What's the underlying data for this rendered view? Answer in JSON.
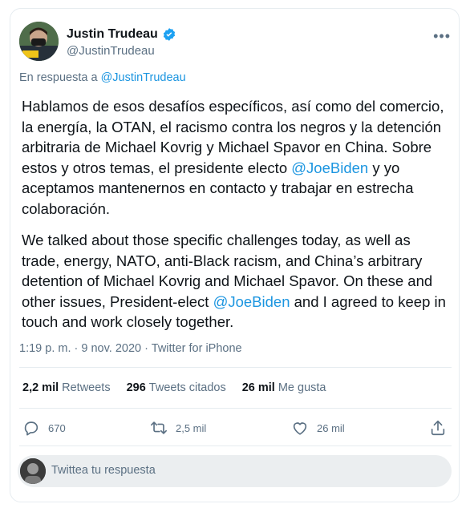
{
  "author": {
    "name": "Justin Trudeau",
    "handle": "@JustinTrudeau"
  },
  "reply_context": {
    "prefix": "En respuesta a",
    "mention": "@JustinTrudeau"
  },
  "tweet": {
    "p1_before": "Hablamos de esos desafíos específicos, así como del comercio, la energía, la OTAN, el racismo contra los negros y la detención arbitraria de Michael Kovrig y Michael Spavor en China. Sobre estos y otros temas, el presidente electo ",
    "p1_mention": "@JoeBiden",
    "p1_after": " y yo aceptamos mantenernos en contacto y trabajar en estrecha colaboración.",
    "p2_before": "We talked about those specific challenges today, as well as trade, energy, NATO, anti-Black racism, and China’s arbitrary detention of Michael Kovrig and Michael Spavor. On these and other issues, President-elect ",
    "p2_mention": "@JoeBiden",
    "p2_after": " and I agreed to keep in touch and work closely together."
  },
  "meta": {
    "time": "1:19 p. m.",
    "separator": "·",
    "date": "9 nov. 2020",
    "source": "Twitter for iPhone"
  },
  "stats": {
    "retweets_count": "2,2 mil",
    "retweets_label": "Retweets",
    "quotes_count": "296",
    "quotes_label": "Tweets citados",
    "likes_count": "26 mil",
    "likes_label": "Me gusta"
  },
  "actions": {
    "reply_count": "670",
    "retweet_count": "2,5 mil",
    "like_count": "26 mil"
  },
  "reply_box": {
    "placeholder": "Twittea tu respuesta"
  },
  "icons": {
    "more": "more-horizontal-icon",
    "verified": "verified-badge-icon",
    "reply": "reply-bubble-icon",
    "retweet": "retweet-icon",
    "like": "heart-icon",
    "share": "share-icon"
  },
  "colors": {
    "link": "#1b95e0",
    "secondary_text": "#5b7083",
    "verified": "#1da1f2"
  }
}
